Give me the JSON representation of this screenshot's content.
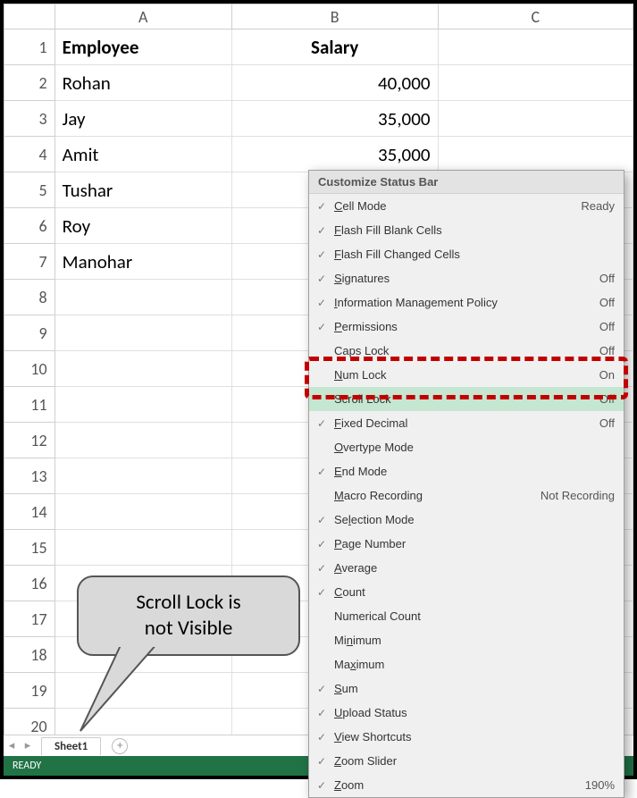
{
  "columns": [
    "A",
    "B",
    "C"
  ],
  "headers": {
    "A": "Employee",
    "B": "Salary"
  },
  "rows": [
    {
      "n": 1,
      "A": "Employee",
      "B": "Salary",
      "B_is_header": true,
      "A_bold": true
    },
    {
      "n": 2,
      "A": "Rohan",
      "B": "40,000"
    },
    {
      "n": 3,
      "A": "Jay",
      "B": "35,000"
    },
    {
      "n": 4,
      "A": "Amit",
      "B": "35,000"
    },
    {
      "n": 5,
      "A": "Tushar",
      "B": ""
    },
    {
      "n": 6,
      "A": "Roy",
      "B": ""
    },
    {
      "n": 7,
      "A": "Manohar",
      "B": ""
    },
    {
      "n": 8
    },
    {
      "n": 9
    },
    {
      "n": 10
    },
    {
      "n": 11
    },
    {
      "n": 12
    },
    {
      "n": 13
    },
    {
      "n": 14
    },
    {
      "n": 15
    },
    {
      "n": 16
    },
    {
      "n": 17
    },
    {
      "n": 18
    },
    {
      "n": 19
    },
    {
      "n": 20
    }
  ],
  "sheet_tab": "Sheet1",
  "status_ready": "READY",
  "callout": {
    "line1": "Scroll Lock is",
    "line2": "not Visible"
  },
  "context_menu": {
    "title": "Customize Status Bar",
    "items": [
      {
        "checked": true,
        "label": "Cell Mode",
        "ul": 0,
        "value": "Ready"
      },
      {
        "checked": true,
        "label": "Flash Fill Blank Cells",
        "ul": 0
      },
      {
        "checked": true,
        "label": "Flash Fill Changed Cells",
        "ul": 0
      },
      {
        "checked": true,
        "label": "Signatures",
        "ul": 0,
        "value": "Off"
      },
      {
        "checked": true,
        "label": "Information Management Policy",
        "ul": 0,
        "value": "Off"
      },
      {
        "checked": true,
        "label": "Permissions",
        "ul": 0,
        "value": "Off"
      },
      {
        "checked": false,
        "label": "Caps Lock",
        "value": "Off"
      },
      {
        "checked": false,
        "label": "Num Lock",
        "ul": 0,
        "value": "On"
      },
      {
        "checked": false,
        "label": "Scroll Lock",
        "value": "Off",
        "highlight": true
      },
      {
        "checked": true,
        "label": "Fixed Decimal",
        "ul": 0,
        "value": "Off"
      },
      {
        "checked": false,
        "label": "Overtype Mode",
        "ul": 0
      },
      {
        "checked": true,
        "label": "End Mode",
        "ul": 0
      },
      {
        "checked": false,
        "label": "Macro Recording",
        "ul": 0,
        "value": "Not Recording"
      },
      {
        "checked": true,
        "label": "Selection Mode",
        "ul": 2
      },
      {
        "checked": true,
        "label": "Page Number",
        "ul": 0
      },
      {
        "checked": true,
        "label": "Average",
        "ul": 0
      },
      {
        "checked": true,
        "label": "Count",
        "ul": 0
      },
      {
        "checked": false,
        "label": "Numerical Count"
      },
      {
        "checked": false,
        "label": "Minimum",
        "ul": 2
      },
      {
        "checked": false,
        "label": "Maximum",
        "ul": 2
      },
      {
        "checked": true,
        "label": "Sum",
        "ul": 0
      },
      {
        "checked": true,
        "label": "Upload Status",
        "ul": 0
      },
      {
        "checked": true,
        "label": "View Shortcuts",
        "ul": 0
      },
      {
        "checked": true,
        "label": "Zoom Slider",
        "ul": 0
      },
      {
        "checked": true,
        "label": "Zoom",
        "ul": 0,
        "value": "190%"
      }
    ]
  }
}
